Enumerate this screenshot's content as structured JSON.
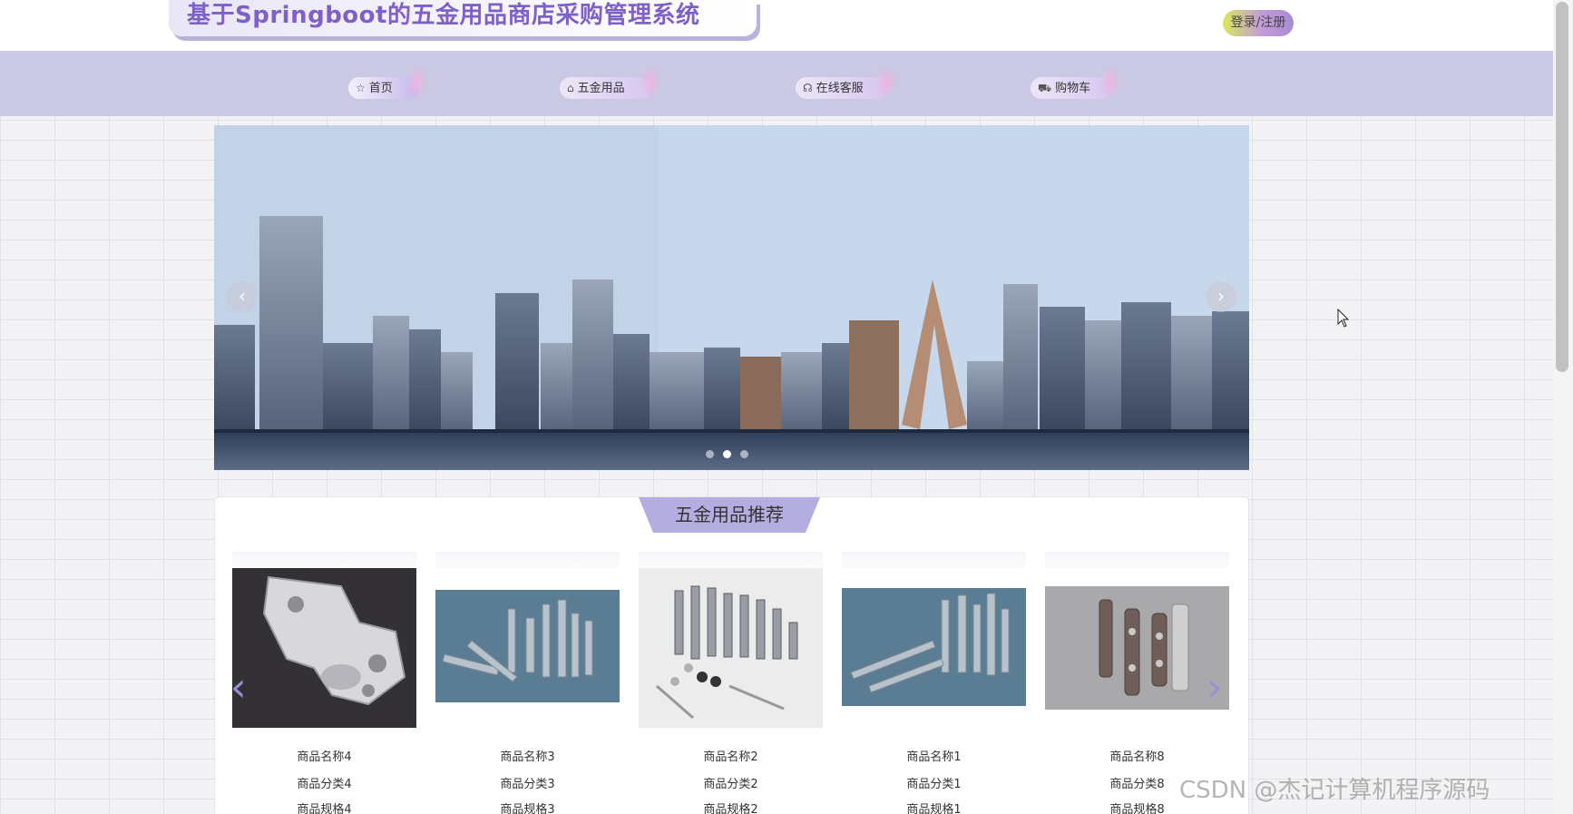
{
  "header": {
    "title": "基于Springboot的五金用品商店采购管理系统",
    "login_label": "登录/注册"
  },
  "nav": {
    "items": [
      {
        "label": "首页",
        "icon": "star-icon"
      },
      {
        "label": "五金用品",
        "icon": "bag-icon"
      },
      {
        "label": "在线客服",
        "icon": "headset-icon"
      },
      {
        "label": "购物车",
        "icon": "cart-icon"
      }
    ]
  },
  "banner": {
    "slide_count": 3,
    "active_slide": 2
  },
  "recommend": {
    "title": "五金用品推荐",
    "products": [
      {
        "name": "商品名称4",
        "category": "商品分类4",
        "spec": "商品规格4"
      },
      {
        "name": "商品名称3",
        "category": "商品分类3",
        "spec": "商品规格3"
      },
      {
        "name": "商品名称2",
        "category": "商品分类2",
        "spec": "商品规格2"
      },
      {
        "name": "商品名称1",
        "category": "商品分类1",
        "spec": "商品规格1"
      },
      {
        "name": "商品名称8",
        "category": "商品分类8",
        "spec": "商品规格8"
      }
    ]
  },
  "watermark": "CSDN @杰记计算机程序源码",
  "colors": {
    "nav_bg": "#c9c9e3",
    "title_text": "#7e60c8",
    "section_title_bg": "#b4aee0"
  }
}
